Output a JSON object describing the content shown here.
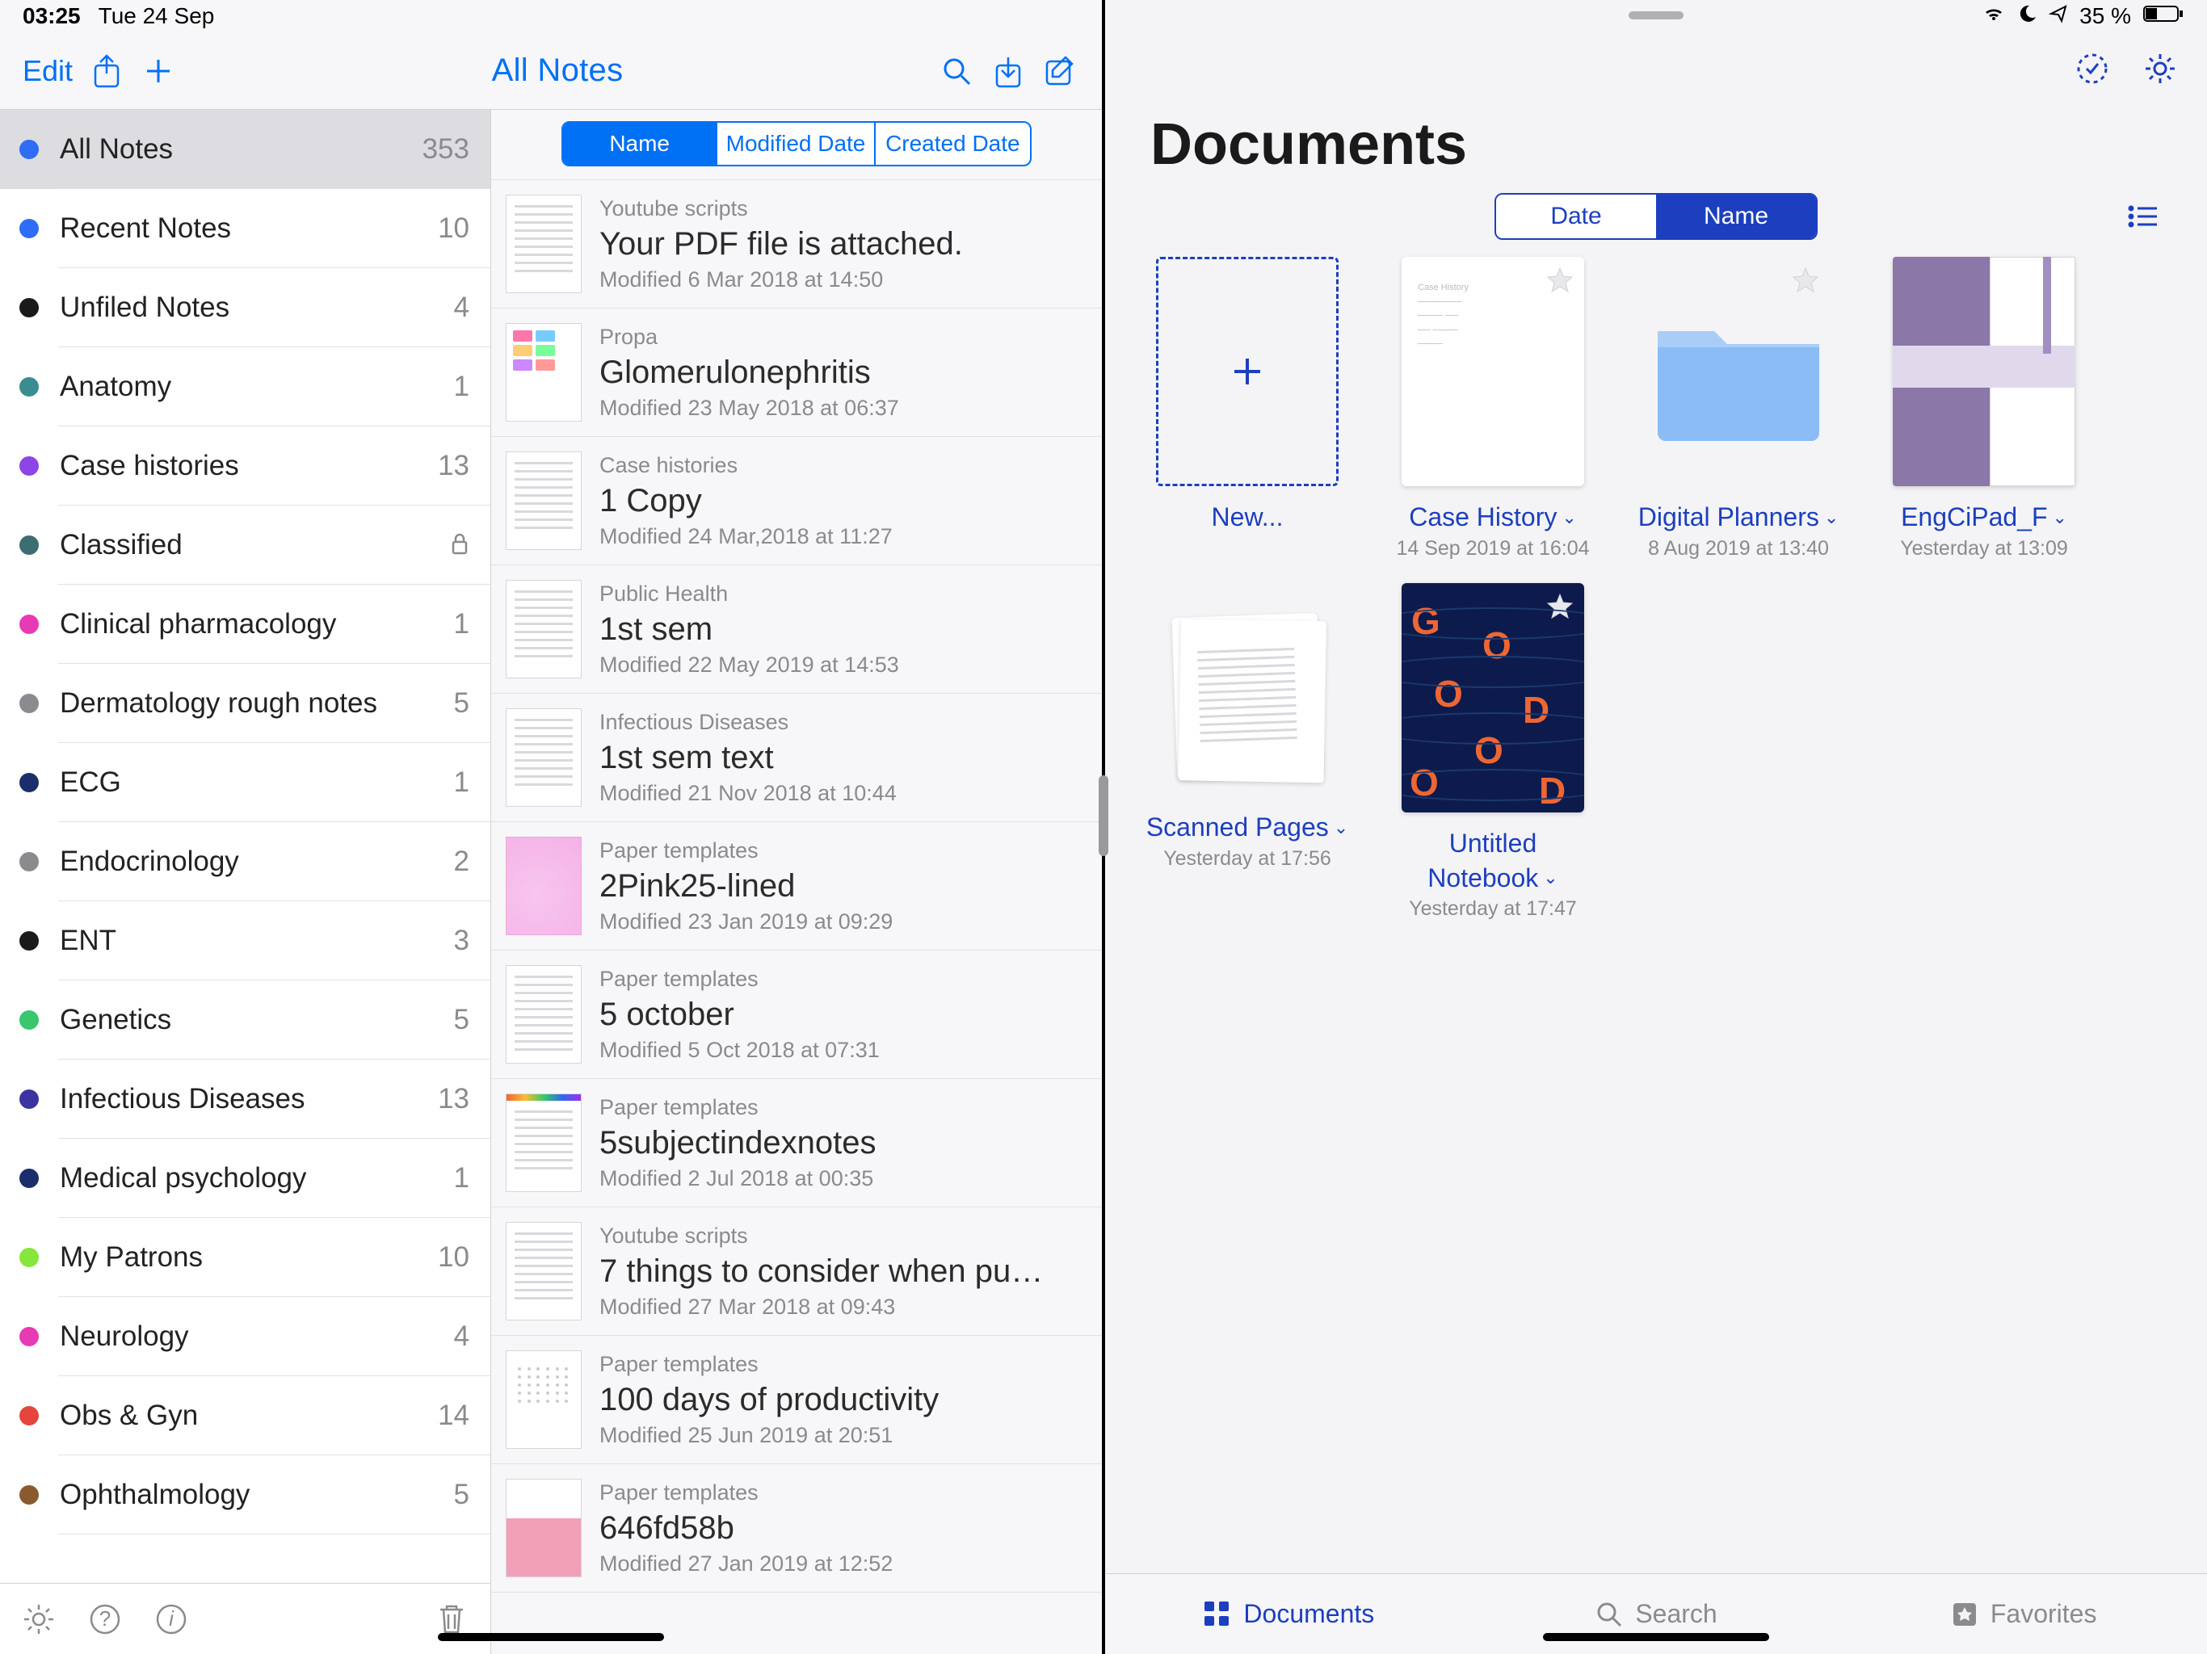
{
  "status": {
    "time": "03:25",
    "date": "Tue 24 Sep",
    "battery_pct": "35 %"
  },
  "left": {
    "toolbar": {
      "edit": "Edit",
      "title": "All Notes"
    },
    "sidebar": [
      {
        "label": "All Notes",
        "count": "353",
        "dot": "c-blue",
        "selected": true
      },
      {
        "label": "Recent Notes",
        "count": "10",
        "dot": "c-blue"
      },
      {
        "label": "Unfiled Notes",
        "count": "4",
        "dot": "c-black"
      },
      {
        "label": "Anatomy",
        "count": "1",
        "dot": "c-teal"
      },
      {
        "label": "Case histories",
        "count": "13",
        "dot": "c-purple"
      },
      {
        "label": "Classified",
        "count": "",
        "dot": "c-darkteal",
        "lock": true
      },
      {
        "label": "Clinical pharmacology",
        "count": "1",
        "dot": "c-magenta"
      },
      {
        "label": "Dermatology rough notes",
        "count": "5",
        "dot": "c-gray"
      },
      {
        "label": "ECG",
        "count": "1",
        "dot": "c-navy"
      },
      {
        "label": "Endocrinology",
        "count": "2",
        "dot": "c-gray"
      },
      {
        "label": "ENT",
        "count": "3",
        "dot": "c-black"
      },
      {
        "label": "Genetics",
        "count": "5",
        "dot": "c-green"
      },
      {
        "label": "Infectious Diseases",
        "count": "13",
        "dot": "c-indigo"
      },
      {
        "label": "Medical psychology",
        "count": "1",
        "dot": "c-navy"
      },
      {
        "label": "My Patrons",
        "count": "10",
        "dot": "c-lime"
      },
      {
        "label": "Neurology",
        "count": "4",
        "dot": "c-magenta"
      },
      {
        "label": "Obs & Gyn",
        "count": "14",
        "dot": "c-red"
      },
      {
        "label": "Ophthalmology",
        "count": "5",
        "dot": "c-brown"
      }
    ],
    "sort": {
      "name": "Name",
      "modified": "Modified Date",
      "created": "Created Date"
    },
    "notes": [
      {
        "cat": "Youtube scripts",
        "title": "Your PDF file is attached.",
        "mod": "Modified 6 Mar 2018 at 14:50",
        "thumb": "lines"
      },
      {
        "cat": "Propa",
        "title": "Glomerulonephritis",
        "mod": "Modified 23 May 2018 at 06:37",
        "thumb": "color"
      },
      {
        "cat": "Case histories",
        "title": "1 Copy",
        "mod": "Modified 24 Mar,2018 at 11:27",
        "thumb": "lines"
      },
      {
        "cat": "Public Health",
        "title": "1st sem",
        "mod": "Modified 22 May 2019 at 14:53",
        "thumb": "lines"
      },
      {
        "cat": "Infectious Diseases",
        "title": "1st sem text",
        "mod": "Modified 21 Nov 2018 at 10:44",
        "thumb": "lines"
      },
      {
        "cat": "Paper templates",
        "title": "2Pink25-lined",
        "mod": "Modified 23 Jan 2019 at 09:29",
        "thumb": "pink"
      },
      {
        "cat": "Paper templates",
        "title": "5 october",
        "mod": "Modified 5 Oct 2018 at 07:31",
        "thumb": "grid"
      },
      {
        "cat": "Paper templates",
        "title": "5subjectindexnotes",
        "mod": "Modified 2 Jul 2018 at 00:35",
        "thumb": "redtop"
      },
      {
        "cat": "Youtube scripts",
        "title": "7 things to consider when pu…",
        "mod": "Modified 27 Mar 2018 at 09:43",
        "thumb": "lines"
      },
      {
        "cat": "Paper templates",
        "title": "100 days of productivity",
        "mod": "Modified 25 Jun 2019 at 20:51",
        "thumb": "dots"
      },
      {
        "cat": "Paper templates",
        "title": "646fd58b",
        "mod": "Modified 27 Jan 2019 at 12:52",
        "thumb": "pink2"
      }
    ]
  },
  "right": {
    "title": "Documents",
    "seg": {
      "date": "Date",
      "name": "Name"
    },
    "docs": [
      {
        "kind": "new",
        "name": "New...",
        "date": ""
      },
      {
        "kind": "paper",
        "name": "Case History",
        "date": "14 Sep 2019 at 16:04",
        "star": true,
        "chev": true
      },
      {
        "kind": "folder",
        "name": "Digital Planners",
        "date": "8 Aug 2019 at 13:40",
        "star": true,
        "chev": true
      },
      {
        "kind": "planner",
        "name": "EngCiPad_F",
        "date": "Yesterday at 13:09",
        "chev": true
      },
      {
        "kind": "scanned",
        "name": "Scanned Pages",
        "date": "Yesterday at 17:56",
        "chev": true
      },
      {
        "kind": "gnotes",
        "name": "Untitled Notebook",
        "date": "Yesterday at 17:47",
        "star": true,
        "chev": true,
        "wrap": true
      }
    ],
    "tabs": {
      "documents": "Documents",
      "search": "Search",
      "favorites": "Favorites"
    }
  }
}
